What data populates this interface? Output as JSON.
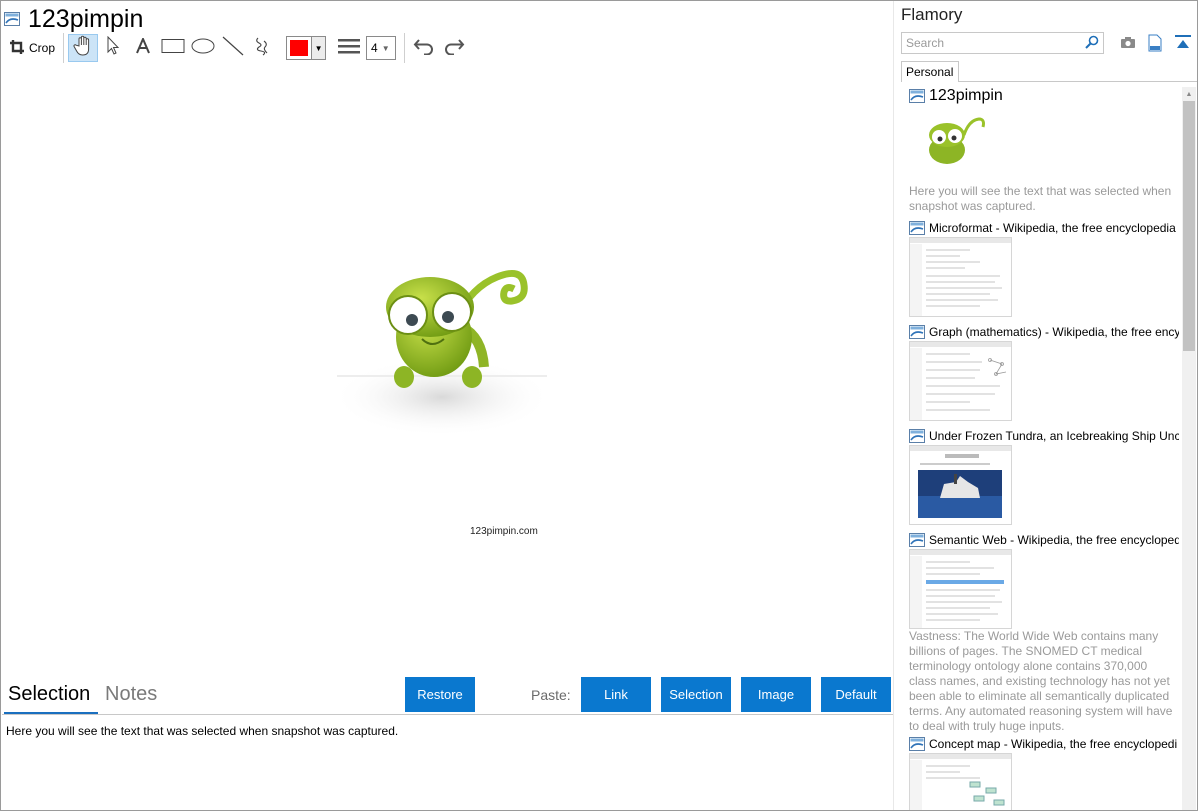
{
  "document": {
    "title": "123pimpin"
  },
  "toolbar": {
    "crop_label": "Crop",
    "line_width_value": "4",
    "active_color": "#ff0000",
    "tools": [
      "crop-icon",
      "hand-icon",
      "pointer-icon",
      "text-icon",
      "rectangle-icon",
      "ellipse-icon",
      "line-icon",
      "freehand-icon",
      "line-width-icon",
      "undo-icon",
      "redo-icon"
    ]
  },
  "canvas": {
    "snapshot_caption": "123pimpin.com"
  },
  "notes": {
    "tab_selection": "Selection",
    "tab_notes": "Notes",
    "restore_label": "Restore",
    "paste_label": "Paste:",
    "paste_buttons": [
      "Link",
      "Selection",
      "Image",
      "Default"
    ],
    "selection_text": "Here you will see the text that was selected when snapshot was captured."
  },
  "sidebar": {
    "app_name": "Flamory",
    "search_placeholder": "Search",
    "tab_label": "Personal",
    "items": [
      {
        "title": "123pimpin",
        "text": "Here you will see the text that was selected when snapshot was captured."
      },
      {
        "title": "Microformat - Wikipedia, the free encyclopedia",
        "text": ""
      },
      {
        "title": "Graph (mathematics) - Wikipedia, the free ency",
        "text": ""
      },
      {
        "title": "Under Frozen Tundra, an Icebreaking Ship Unco",
        "text": ""
      },
      {
        "title": "Semantic Web - Wikipedia, the free encycloped",
        "text": "Vastness: The World Wide Web contains many billions of pages. The SNOMED CT medical terminology ontology alone contains 370,000 class names, and existing technology has not yet been able to eliminate all semantically duplicated terms. Any automated reasoning system will have to deal with truly huge inputs."
      },
      {
        "title": "Concept map - Wikipedia, the free encyclopedi",
        "text": ""
      }
    ]
  },
  "colors": {
    "accent": "#0a78cf",
    "tab_underline": "#1a6fbf"
  }
}
